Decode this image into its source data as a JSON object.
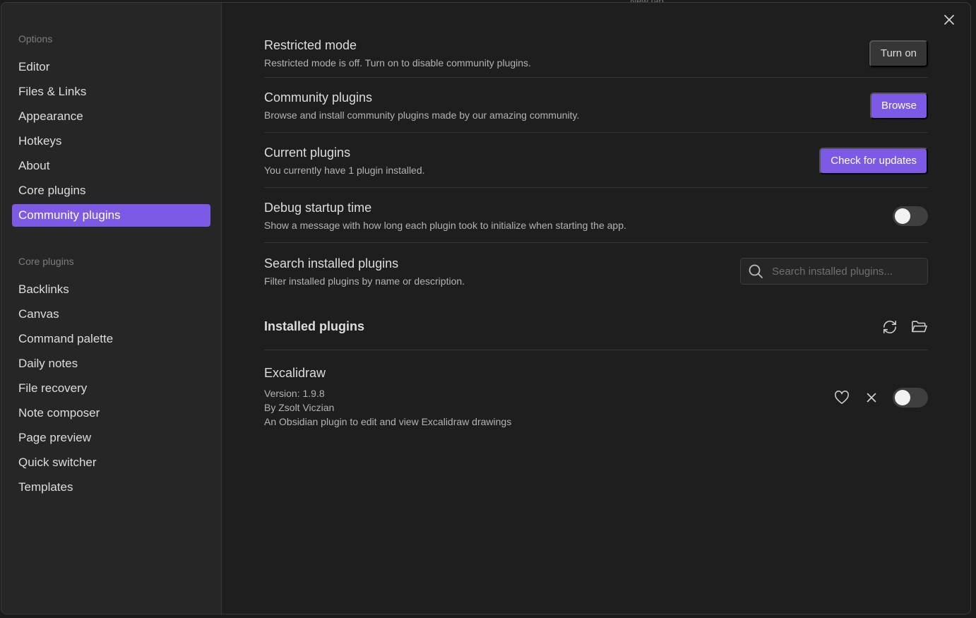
{
  "background": {
    "tab_hint": "New tab"
  },
  "sidebar": {
    "options_heading": "Options",
    "options_items": [
      {
        "label": "Editor"
      },
      {
        "label": "Files & Links"
      },
      {
        "label": "Appearance"
      },
      {
        "label": "Hotkeys"
      },
      {
        "label": "About"
      },
      {
        "label": "Core plugins"
      },
      {
        "label": "Community plugins",
        "active": true
      }
    ],
    "core_heading": "Core plugins",
    "core_items": [
      {
        "label": "Backlinks"
      },
      {
        "label": "Canvas"
      },
      {
        "label": "Command palette"
      },
      {
        "label": "Daily notes"
      },
      {
        "label": "File recovery"
      },
      {
        "label": "Note composer"
      },
      {
        "label": "Page preview"
      },
      {
        "label": "Quick switcher"
      },
      {
        "label": "Templates"
      }
    ]
  },
  "settings": {
    "restricted": {
      "name": "Restricted mode",
      "desc": "Restricted mode is off. Turn on to disable community plugins.",
      "button": "Turn on"
    },
    "community": {
      "name": "Community plugins",
      "desc": "Browse and install community plugins made by our amazing community.",
      "button": "Browse"
    },
    "current": {
      "name": "Current plugins",
      "desc": "You currently have 1 plugin installed.",
      "button": "Check for updates"
    },
    "debug": {
      "name": "Debug startup time",
      "desc": "Show a message with how long each plugin took to initialize when starting the app.",
      "enabled": false
    },
    "search": {
      "name": "Search installed plugins",
      "desc": "Filter installed plugins by name or description.",
      "placeholder": "Search installed plugins...",
      "value": ""
    }
  },
  "installed": {
    "title": "Installed plugins",
    "plugins": [
      {
        "name": "Excalidraw",
        "version": "Version: 1.9.8",
        "author": "By Zsolt Viczian",
        "description": "An Obsidian plugin to edit and view Excalidraw drawings",
        "enabled": false
      }
    ]
  },
  "colors": {
    "accent": "#7c5ae6",
    "background": "#1e1e1e",
    "sidebar": "#262626"
  },
  "icons": {
    "close": "close-icon",
    "search": "search-icon",
    "reload": "reload-icon",
    "folder": "folder-open-icon",
    "heart": "heart-icon",
    "uninstall": "close-icon"
  }
}
